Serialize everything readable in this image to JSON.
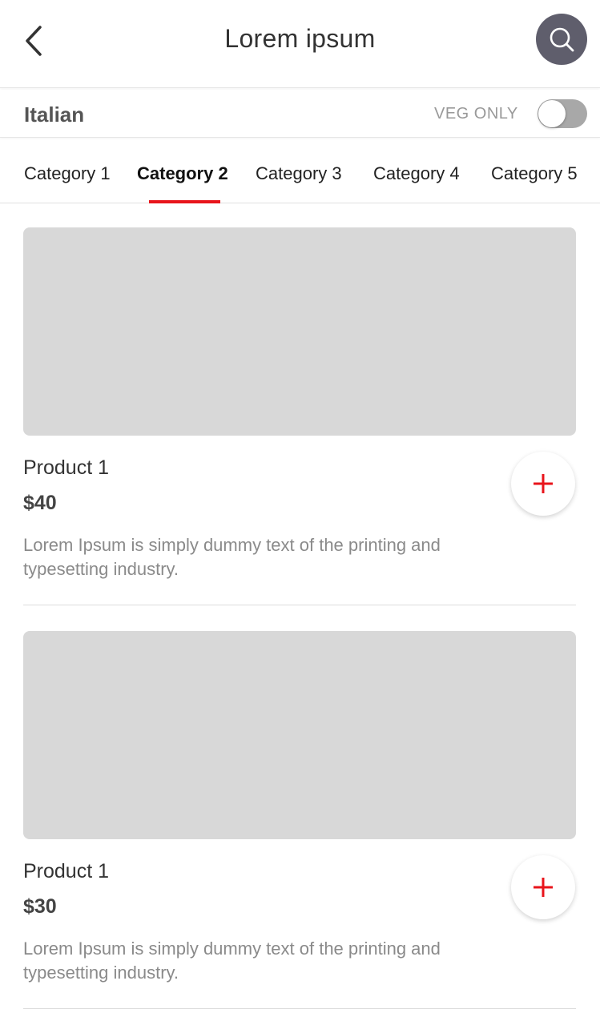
{
  "header": {
    "title": "Lorem ipsum",
    "back_icon": "chevron-left-icon",
    "search_icon": "search-icon",
    "search_button_color": "#5f5e6c"
  },
  "filter": {
    "cuisine": "Italian",
    "veg_label": "VEG ONLY",
    "veg_only_on": false
  },
  "tabs": [
    {
      "label": "Category 1",
      "active": false
    },
    {
      "label": "Category 2",
      "active": true
    },
    {
      "label": "Category 3",
      "active": false
    },
    {
      "label": "Category 4",
      "active": false
    },
    {
      "label": "Category 5",
      "active": false
    }
  ],
  "accent_color": "#e8141b",
  "products": [
    {
      "name": "Product 1",
      "price": "$40",
      "description": "Lorem Ipsum is simply dummy text of the printing and typesetting industry.",
      "add_icon": "plus-icon"
    },
    {
      "name": "Product 1",
      "price": "$30",
      "description": "Lorem Ipsum is simply dummy text of the printing and typesetting industry.",
      "add_icon": "plus-icon"
    }
  ]
}
